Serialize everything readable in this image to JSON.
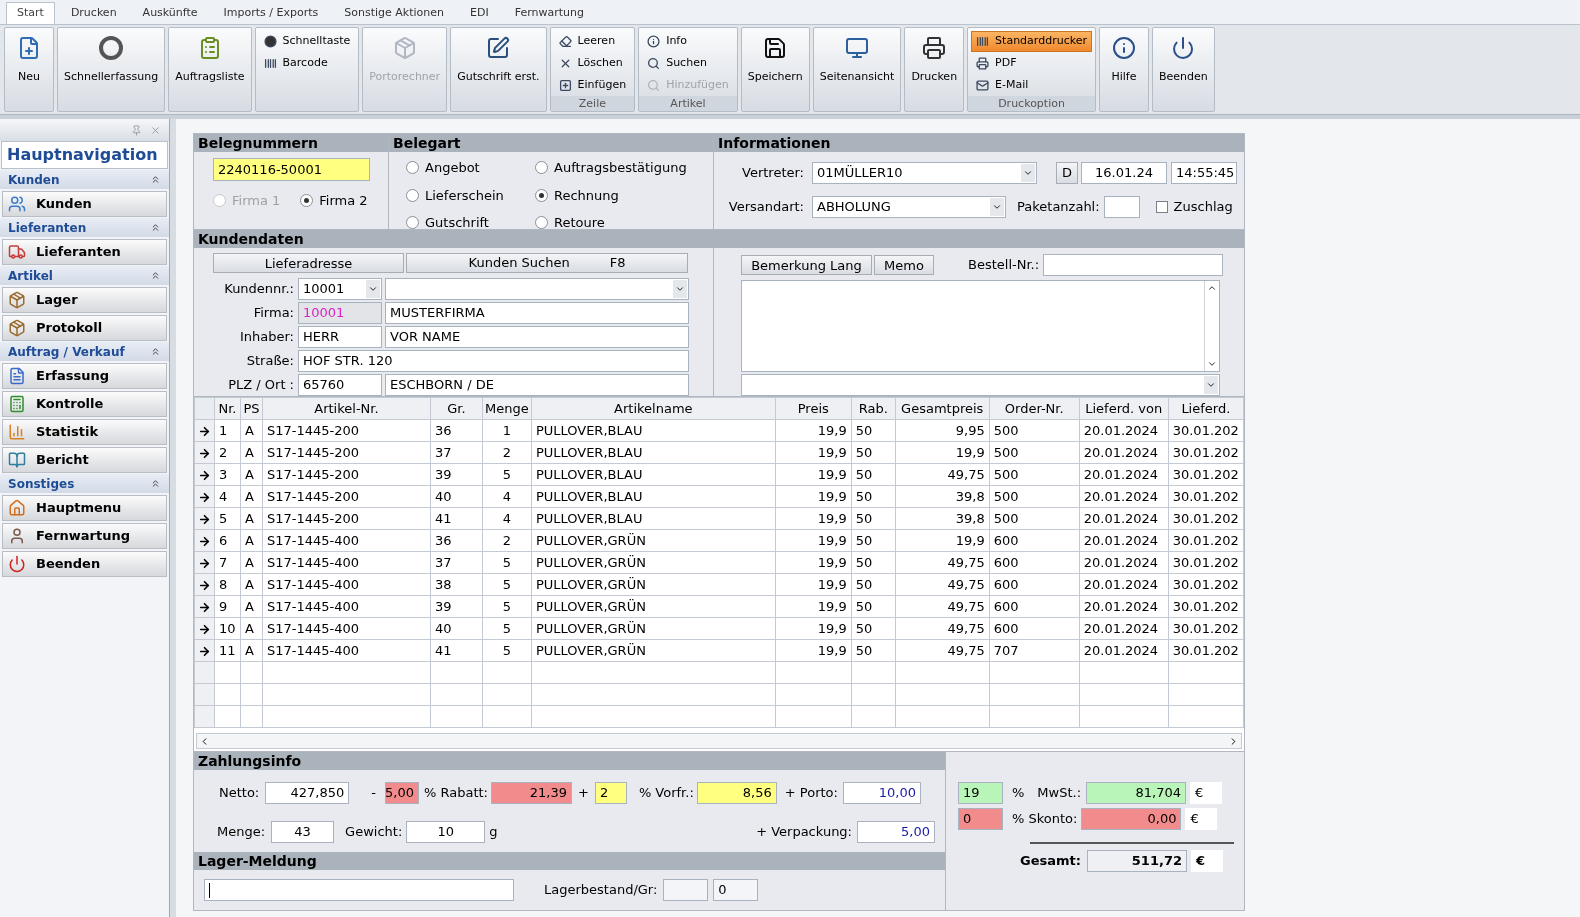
{
  "ribbon": {
    "tabs": [
      {
        "label": "Start",
        "selected": true
      },
      {
        "label": "Drucken",
        "selected": false
      },
      {
        "label": "Auskünfte",
        "selected": false
      },
      {
        "label": "Imports / Exports",
        "selected": false
      },
      {
        "label": "Sonstige Aktionen",
        "selected": false
      },
      {
        "label": "EDI",
        "selected": false
      },
      {
        "label": "Fernwartung",
        "selected": false
      }
    ],
    "groups": [
      {
        "kind": "large",
        "label": "Neu",
        "disabled": false
      },
      {
        "kind": "large",
        "label": "Schnellerfassung",
        "disabled": false
      },
      {
        "kind": "large",
        "label": "Auftragsliste",
        "disabled": false
      },
      {
        "kind": "stack",
        "items": [
          {
            "label": "Schnelltaste",
            "disabled": false
          },
          {
            "label": "Barcode",
            "disabled": false
          }
        ]
      },
      {
        "kind": "large",
        "label": "Portorechner",
        "disabled": true
      },
      {
        "kind": "large",
        "label": "Gutschrift erst.",
        "disabled": false
      },
      {
        "kind": "stack",
        "caption": "Zeile",
        "items": [
          {
            "label": "Leeren",
            "disabled": false
          },
          {
            "label": "Löschen",
            "disabled": false
          },
          {
            "label": "Einfügen",
            "disabled": false
          }
        ]
      },
      {
        "kind": "stack",
        "caption": "Artikel",
        "items": [
          {
            "label": "Info",
            "disabled": false
          },
          {
            "label": "Suchen",
            "disabled": false
          },
          {
            "label": "Hinzufügen",
            "disabled": true
          }
        ]
      },
      {
        "kind": "large",
        "label": "Speichern",
        "disabled": false
      },
      {
        "kind": "large",
        "label": "Seitenansicht",
        "disabled": false
      },
      {
        "kind": "large",
        "label": "Drucken",
        "disabled": false
      },
      {
        "kind": "stack",
        "caption": "Druckoption",
        "items": [
          {
            "label": "Standarddrucker",
            "disabled": false,
            "selected": true
          },
          {
            "label": "PDF",
            "disabled": false,
            "selected": false
          },
          {
            "label": "E-Mail",
            "disabled": false,
            "selected": false
          }
        ]
      },
      {
        "kind": "large",
        "label": "Hilfe",
        "disabled": false
      },
      {
        "kind": "large",
        "label": "Beenden",
        "disabled": false
      }
    ]
  },
  "sidebar": {
    "title": "Hauptnavigation",
    "sections": [
      {
        "title": "Kunden",
        "items": [
          "Kunden"
        ]
      },
      {
        "title": "Lieferanten",
        "items": [
          "Lieferanten"
        ]
      },
      {
        "title": "Artikel",
        "items": [
          "Lager",
          "Protokoll"
        ]
      },
      {
        "title": "Auftrag / Verkauf",
        "items": [
          "Erfassung",
          "Kontrolle",
          "Statistik",
          "Bericht"
        ]
      },
      {
        "title": "Sonstiges",
        "items": [
          "Hauptmenu",
          "Fernwartung",
          "Beenden"
        ]
      }
    ]
  },
  "belegnummern": {
    "title": "Belegnummern",
    "number": "2240116-50001",
    "firma": [
      {
        "label": "Firma 1",
        "selected": false,
        "disabled": true
      },
      {
        "label": "Firma 2",
        "selected": true,
        "disabled": false
      }
    ]
  },
  "belegart": {
    "title": "Belegart",
    "options": [
      {
        "label": "Angebot",
        "selected": false
      },
      {
        "label": "Auftragsbestätigung",
        "selected": false
      },
      {
        "label": "Lieferschein",
        "selected": false
      },
      {
        "label": "Rechnung",
        "selected": true
      },
      {
        "label": "Gutschrift",
        "selected": false
      },
      {
        "label": "Retoure",
        "selected": false
      }
    ]
  },
  "informationen": {
    "title": "Informationen",
    "vertreter": {
      "label": "Vertreter:",
      "value": "01MÜLLER10"
    },
    "d_button": "D",
    "date": "16.01.24",
    "time": "14:55:45",
    "versandart": {
      "label": "Versandart:",
      "value": "ABHOLUNG"
    },
    "paketanzahl": {
      "label": "Paketanzahl:"
    },
    "zuschlag": {
      "label": "Zuschlag",
      "checked": false
    }
  },
  "kundendaten": {
    "title": "Kundendaten",
    "buttons": [
      {
        "label": "Lieferadresse"
      },
      {
        "label": "Kunden Suchen",
        "shortcut": "F8"
      }
    ],
    "rows": [
      {
        "label": "Kundennr.:",
        "fields": [
          {
            "kind": "combo",
            "value": "10001"
          },
          {
            "kind": "combo"
          }
        ]
      },
      {
        "label": "Firma:",
        "fields": [
          {
            "kind": "readonly",
            "value": "10001",
            "color": "#e020c8"
          },
          {
            "kind": "text",
            "value": "MUSTERFIRMA"
          }
        ]
      },
      {
        "label": "Inhaber:",
        "fields": [
          {
            "kind": "text",
            "value": "HERR"
          },
          {
            "kind": "text",
            "value": "VOR NAME"
          }
        ]
      },
      {
        "label": "Straße:",
        "fields": [
          {
            "kind": "wide",
            "value": "HOF STR. 120"
          }
        ]
      },
      {
        "label": "PLZ / Ort :",
        "fields": [
          {
            "kind": "text",
            "value": "65760"
          },
          {
            "kind": "text",
            "value": "ESCHBORN / DE"
          }
        ]
      }
    ],
    "remark_buttons": [
      "Bemerkung Lang",
      "Memo"
    ],
    "bestell_label": "Bestell-Nr.:"
  },
  "table": {
    "columns": [
      "Nr.",
      "PS",
      "Artikel-Nr.",
      "Gr.",
      "Menge",
      "Artikelname",
      "Preis",
      "Rab.",
      "Gesamtpreis",
      "Order-Nr.",
      "Lieferd. von",
      "Lieferd."
    ],
    "rows": [
      [
        "1",
        "A",
        "S17-1445-200",
        "36",
        "1",
        "PULLOVER,BLAU",
        "19,9",
        "50",
        "9,95",
        "500",
        "20.01.2024",
        "30.01.202"
      ],
      [
        "2",
        "A",
        "S17-1445-200",
        "37",
        "2",
        "PULLOVER,BLAU",
        "19,9",
        "50",
        "19,9",
        "500",
        "20.01.2024",
        "30.01.202"
      ],
      [
        "3",
        "A",
        "S17-1445-200",
        "39",
        "5",
        "PULLOVER,BLAU",
        "19,9",
        "50",
        "49,75",
        "500",
        "20.01.2024",
        "30.01.202"
      ],
      [
        "4",
        "A",
        "S17-1445-200",
        "40",
        "4",
        "PULLOVER,BLAU",
        "19,9",
        "50",
        "39,8",
        "500",
        "20.01.2024",
        "30.01.202"
      ],
      [
        "5",
        "A",
        "S17-1445-200",
        "41",
        "4",
        "PULLOVER,BLAU",
        "19,9",
        "50",
        "39,8",
        "500",
        "20.01.2024",
        "30.01.202"
      ],
      [
        "6",
        "A",
        "S17-1445-400",
        "36",
        "2",
        "PULLOVER,GRÜN",
        "19,9",
        "50",
        "19,9",
        "600",
        "20.01.2024",
        "30.01.202"
      ],
      [
        "7",
        "A",
        "S17-1445-400",
        "37",
        "5",
        "PULLOVER,GRÜN",
        "19,9",
        "50",
        "49,75",
        "600",
        "20.01.2024",
        "30.01.202"
      ],
      [
        "8",
        "A",
        "S17-1445-400",
        "38",
        "5",
        "PULLOVER,GRÜN",
        "19,9",
        "50",
        "49,75",
        "600",
        "20.01.2024",
        "30.01.202"
      ],
      [
        "9",
        "A",
        "S17-1445-400",
        "39",
        "5",
        "PULLOVER,GRÜN",
        "19,9",
        "50",
        "49,75",
        "600",
        "20.01.2024",
        "30.01.202"
      ],
      [
        "10",
        "A",
        "S17-1445-400",
        "40",
        "5",
        "PULLOVER,GRÜN",
        "19,9",
        "50",
        "49,75",
        "600",
        "20.01.2024",
        "30.01.202"
      ],
      [
        "11",
        "A",
        "S17-1445-400",
        "41",
        "5",
        "PULLOVER,GRÜN",
        "19,9",
        "50",
        "49,75",
        "707",
        "20.01.2024",
        "30.01.202"
      ]
    ]
  },
  "zahlungsinfo": {
    "title": "Zahlungsinfo",
    "netto": {
      "label": "Netto:",
      "value": "427,850"
    },
    "minus": "-",
    "rabatt_pct": {
      "value": "5,00",
      "color": "#f28b8b"
    },
    "rabatt": {
      "label": "% Rabatt:",
      "value": "21,39",
      "color": "#f28b8b"
    },
    "plus": "+",
    "vorfr_pct": {
      "value": "2",
      "color": "#ffff80"
    },
    "vorfr": {
      "label": "% Vorfr.:",
      "value": "8,56",
      "color": "#ffff80"
    },
    "porto": {
      "label": "+ Porto:",
      "value": "10,00"
    },
    "menge": {
      "label": "Menge:",
      "value": "43"
    },
    "gewicht": {
      "label": "Gewicht:",
      "value": "10",
      "unit": "g"
    },
    "verpackung": {
      "label": "+ Verpackung:",
      "value": "5,00"
    },
    "mwst_pct": {
      "value": "19",
      "color": "#b9f5b9"
    },
    "mwst": {
      "pct": "%",
      "label": "MwSt.:",
      "value": "81,704",
      "color": "#b9f5b9",
      "currency": "€"
    },
    "skonto_pct": {
      "value": "0",
      "color": "#f28b8b"
    },
    "skonto": {
      "label": "% Skonto:",
      "value": "0,00",
      "color": "#f28b8b",
      "currency": "€"
    },
    "gesamt": {
      "label": "Gesamt:",
      "value": "511,72",
      "currency": "€"
    }
  },
  "lager": {
    "title": "Lager-Meldung",
    "label": "Lagerbestand/Gr:",
    "value": "0"
  }
}
